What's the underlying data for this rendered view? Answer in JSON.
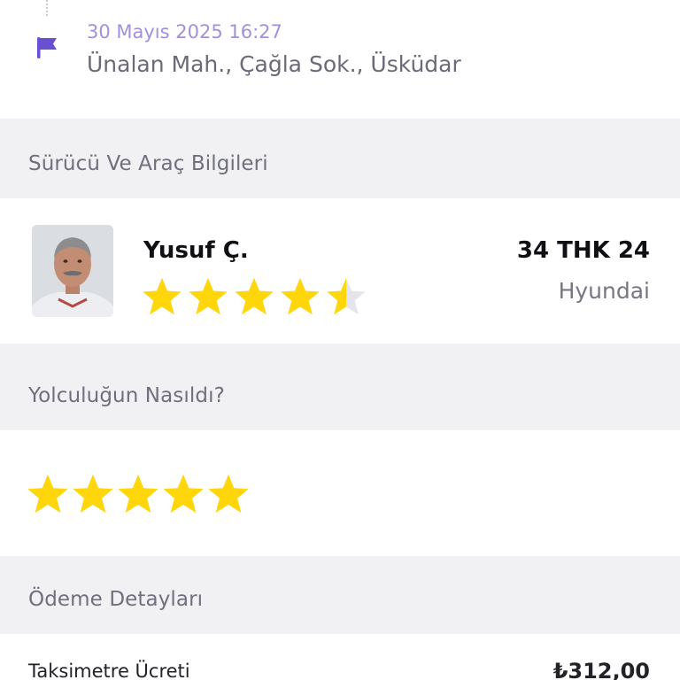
{
  "dropoff": {
    "time": "30 Mayıs 2025 16:27",
    "address": "Ünalan Mah., Çağla Sok., Üsküdar",
    "flag_icon": "flag-icon",
    "accent_color": "#6b4fd3"
  },
  "driver_section": {
    "header": "Sürücü Ve Araç Bilgileri",
    "name": "Yusuf Ç.",
    "rating": 4.5,
    "rating_max": 5,
    "plate": "34 THK 24",
    "car_brand": "Hyundai",
    "star_color": "#ffd60a"
  },
  "trip_rating": {
    "header": "Yolculuğun Nasıldı?",
    "rating": 5,
    "rating_max": 5
  },
  "payment": {
    "header": "Ödeme Detayları",
    "fare_label": "Taksimetre Ücreti",
    "fare_value": "₺312,00"
  }
}
